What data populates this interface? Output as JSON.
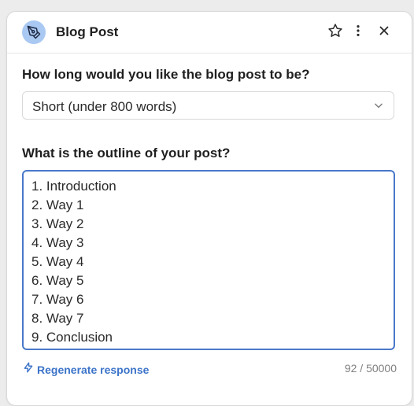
{
  "header": {
    "title": "Blog Post",
    "icons": {
      "app": "pen-nib-icon",
      "favorite": "star-icon",
      "menu": "more-vertical-icon",
      "close": "close-icon"
    }
  },
  "length_question": {
    "label": "How long would you like the blog post to be?",
    "selected": "Short (under 800 words)"
  },
  "outline_question": {
    "label": "What is the outline of your post?",
    "lines": [
      "1. Introduction",
      "2. Way 1",
      "3. Way 2",
      "4. Way 3",
      "5. Way 4",
      "6. Way 5",
      "7. Way 6",
      "8. Way 7",
      "9. Conclusion"
    ]
  },
  "footer": {
    "regenerate_label": "Regenerate response",
    "regenerate_icon": "lightning-bolt-icon",
    "char_count": "92 / 50000"
  },
  "colors": {
    "accent": "#3b73c9",
    "focus_border": "#4a78c9",
    "app_icon_bg": "#a9c8f2"
  }
}
